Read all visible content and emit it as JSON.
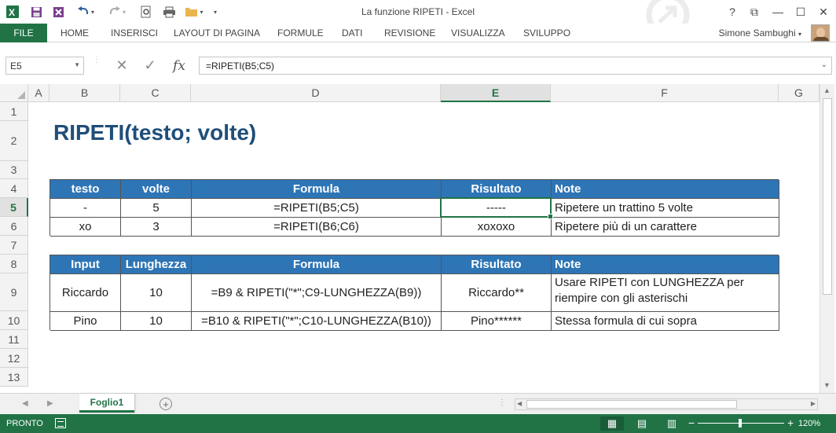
{
  "window": {
    "title": "La funzione RIPETI - Excel",
    "help": "?",
    "restore_ribbon": "⧉",
    "minimize": "—",
    "maximize": "☐",
    "close": "✕"
  },
  "quick_access": {
    "app_icon": "excel-icon",
    "save": "save-icon",
    "undo": "undo-icon",
    "redo": "redo-icon",
    "preview": "print-preview-icon",
    "print": "print-icon",
    "open": "open-folder-icon"
  },
  "ribbon": {
    "file_tab": "FILE",
    "tabs": [
      "HOME",
      "INSERISCI",
      "LAYOUT DI PAGINA",
      "FORMULE",
      "DATI",
      "REVISIONE",
      "VISUALIZZA",
      "SVILUPPO"
    ],
    "user_name": "Simone Sambughi"
  },
  "formula_bar": {
    "name_box": "E5",
    "fx": "fx",
    "formula": "=RIPETI(B5;C5)"
  },
  "grid": {
    "columns": [
      "A",
      "B",
      "C",
      "D",
      "E",
      "F",
      "G"
    ],
    "selected_column": "E",
    "rows": [
      "1",
      "2",
      "3",
      "4",
      "5",
      "6",
      "7",
      "8",
      "9",
      "10",
      "11",
      "12",
      "13"
    ],
    "selected_row": "5"
  },
  "sheet": {
    "heading": "RIPETI(testo; volte)",
    "table1": {
      "headers": [
        "testo",
        "volte",
        "Formula",
        "Risultato",
        "Note"
      ],
      "rows": [
        [
          "-",
          "5",
          "=RIPETI(B5;C5)",
          "-----",
          "Ripetere un trattino 5 volte"
        ],
        [
          "xo",
          "3",
          "=RIPETI(B6;C6)",
          "xoxoxo",
          "Ripetere più di un carattere"
        ]
      ]
    },
    "table2": {
      "headers": [
        "Input",
        "Lunghezza",
        "Formula",
        "Risultato",
        "Note"
      ],
      "rows": [
        [
          "Riccardo",
          "10",
          "=B9 & RIPETI(\"*\";C9-LUNGHEZZA(B9))",
          "Riccardo**",
          "Usare RIPETI con LUNGHEZZA per riempire con gli asterischi"
        ],
        [
          "Pino",
          "10",
          "=B10 & RIPETI(\"*\";C10-LUNGHEZZA(B10))",
          "Pino******",
          "Stessa formula di cui sopra"
        ]
      ]
    }
  },
  "sheet_tabs": {
    "active": "Foglio1",
    "add": "+"
  },
  "status_bar": {
    "ready": "PRONTO",
    "zoom": "120%",
    "zoom_out": "−",
    "zoom_in": "+",
    "zoom_level_percent": 120
  },
  "colors": {
    "excel_green": "#217346",
    "header_blue": "#2e75b6",
    "title_blue": "#1f4e79"
  }
}
